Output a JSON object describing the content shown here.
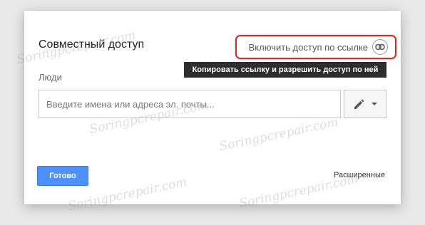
{
  "dialog": {
    "title": "Совместный доступ",
    "link_toggle": {
      "label": "Включить доступ по ссылке",
      "icon": "link-icon"
    },
    "tooltip": "Копировать ссылку и разрешить доступ по ней",
    "people": {
      "label": "Люди",
      "placeholder": "Введите имена или адреса эл. почты...",
      "value": ""
    },
    "permission_icon": "pencil-icon",
    "done_label": "Готово",
    "advanced_label": "Расширенные"
  },
  "watermark": "Soringpcrepair.com",
  "colors": {
    "accent": "#4d90fe",
    "highlight": "#d12b2b",
    "tooltip_bg": "#2d2d2d"
  }
}
